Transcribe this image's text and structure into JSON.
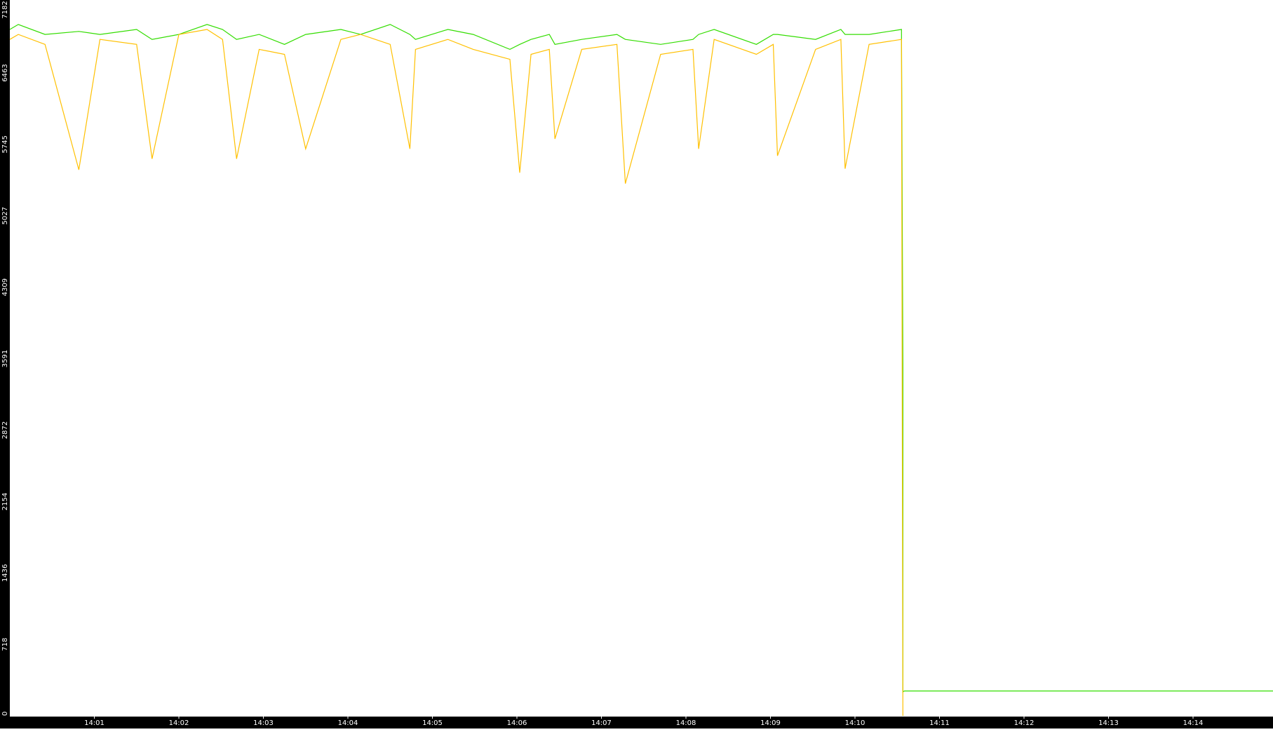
{
  "chart_data": {
    "type": "line",
    "title": "",
    "xlabel": "",
    "ylabel": "",
    "y_ticks": [
      0,
      718,
      1436,
      2154,
      2872,
      3591,
      4309,
      5027,
      5745,
      6463,
      7182
    ],
    "ylim": [
      0,
      7182
    ],
    "x_ticks": [
      "14:01",
      "14:02",
      "14:03",
      "14:04",
      "14:05",
      "14:06",
      "14:07",
      "14:08",
      "14:09",
      "14:10",
      "14:11",
      "14:12",
      "14:13",
      "14:14"
    ],
    "xlim": [
      "14:00:00",
      "14:15:00"
    ],
    "legend": "none",
    "grid": false,
    "colors": {
      "background": "#ffffff",
      "axis_band": "#000000",
      "tick_text": "#ffffff"
    },
    "series": [
      {
        "color": "#33dd00",
        "description": "noisy signal around 6800 dropping to about 240 at 14:10:34",
        "x": [
          "14:00:00",
          "14:00:06",
          "14:00:25",
          "14:00:49",
          "14:01:04",
          "14:01:30",
          "14:01:41",
          "14:02:00",
          "14:02:20",
          "14:02:31",
          "14:02:41",
          "14:02:57",
          "14:03:15",
          "14:03:30",
          "14:03:55",
          "14:04:09",
          "14:04:30",
          "14:04:44",
          "14:04:48",
          "14:05:11",
          "14:05:29",
          "14:05:55",
          "14:06:02",
          "14:06:10",
          "14:06:23",
          "14:06:27",
          "14:06:46",
          "14:07:11",
          "14:07:17",
          "14:07:42",
          "14:08:05",
          "14:08:09",
          "14:08:20",
          "14:08:50",
          "14:09:02",
          "14:09:05",
          "14:09:32",
          "14:09:50",
          "14:09:53",
          "14:10:10",
          "14:10:33",
          "14:10:34",
          "14:10:34",
          "14:10:35",
          "14:11:00",
          "14:12:00",
          "14:13:00",
          "14:14:00",
          "14:15:00"
        ],
        "y": [
          6900,
          6950,
          6850,
          6880,
          6850,
          6900,
          6800,
          6850,
          6950,
          6900,
          6800,
          6850,
          6750,
          6850,
          6900,
          6850,
          6950,
          6850,
          6800,
          6900,
          6850,
          6700,
          6750,
          6800,
          6850,
          6750,
          6800,
          6850,
          6800,
          6750,
          6800,
          6850,
          6900,
          6750,
          6850,
          6850,
          6800,
          6900,
          6850,
          6850,
          6900,
          3500,
          240,
          250,
          250,
          250,
          250,
          250,
          250
        ]
      },
      {
        "color": "#ffc000",
        "description": "noisy signal around 6750 dropping to 0 at 14:10:34",
        "x": [
          "14:00:00",
          "14:00:06",
          "14:00:25",
          "14:00:49",
          "14:01:04",
          "14:01:30",
          "14:01:41",
          "14:02:00",
          "14:02:20",
          "14:02:31",
          "14:02:41",
          "14:02:57",
          "14:03:15",
          "14:03:30",
          "14:03:55",
          "14:04:09",
          "14:04:30",
          "14:04:44",
          "14:04:48",
          "14:05:11",
          "14:05:29",
          "14:05:55",
          "14:06:02",
          "14:06:10",
          "14:06:23",
          "14:06:27",
          "14:06:46",
          "14:07:11",
          "14:07:17",
          "14:07:42",
          "14:08:05",
          "14:08:09",
          "14:08:20",
          "14:08:50",
          "14:09:02",
          "14:09:05",
          "14:09:32",
          "14:09:50",
          "14:09:53",
          "14:10:10",
          "14:10:33",
          "14:10:34"
        ],
        "y": [
          6800,
          6850,
          6750,
          5490,
          6800,
          6750,
          5600,
          6850,
          6900,
          6800,
          5600,
          6700,
          6650,
          5700,
          6800,
          6850,
          6750,
          5700,
          6700,
          6800,
          6700,
          6600,
          5460,
          6650,
          6700,
          5800,
          6700,
          6750,
          5350,
          6650,
          6700,
          5700,
          6800,
          6650,
          6750,
          5630,
          6700,
          6800,
          5500,
          6750,
          6800,
          0
        ]
      }
    ]
  }
}
